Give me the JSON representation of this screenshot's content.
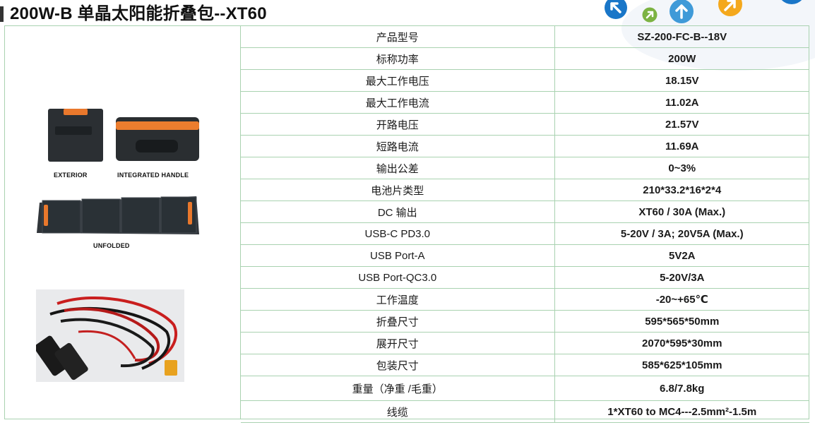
{
  "title": "200W-B 单晶太阳能折叠包--XT60",
  "nav_icons": [
    {
      "name": "arrow-up-left-icon",
      "color": "#1976c8"
    },
    {
      "name": "arrow-up-right-icon",
      "color": "#7cb342"
    },
    {
      "name": "arrow-up-icon",
      "color": "#3f9ad8"
    },
    {
      "name": "arrow-up-right-icon",
      "color": "#f4a81c"
    }
  ],
  "product_image": {
    "labels": {
      "exterior": "EXTERIOR",
      "handle": "INTEGRATED HANDLE",
      "unfolded": "UNFOLDED"
    }
  },
  "specs": [
    {
      "label": "产品型号",
      "value": "SZ-200-FC-B--18V"
    },
    {
      "label": "标称功率",
      "value": "200W"
    },
    {
      "label": "最大工作电压",
      "value": "18.15V"
    },
    {
      "label": "最大工作电流",
      "value": "11.02A"
    },
    {
      "label": "开路电压",
      "value": "21.57V"
    },
    {
      "label": "短路电流",
      "value": "11.69A"
    },
    {
      "label": "输出公差",
      "value": "0~3%"
    },
    {
      "label": "电池片类型",
      "value": "210*33.2*16*2*4"
    },
    {
      "label": "DC 输出",
      "value": "XT60 / 30A (Max.)"
    },
    {
      "label": "USB-C PD3.0",
      "value": "5-20V / 3A; 20V5A (Max.)"
    },
    {
      "label": "USB Port-A",
      "value": "5V2A"
    },
    {
      "label": "USB Port-QC3.0",
      "value": "5-20V/3A"
    },
    {
      "label": "工作温度",
      "value": "-20~+65℃"
    },
    {
      "label": "折叠尺寸",
      "value": "595*565*50mm"
    },
    {
      "label": "展开尺寸",
      "value": "2070*595*30mm"
    },
    {
      "label": "包装尺寸",
      "value": "585*625*105mm"
    },
    {
      "label": "重量（净重 /毛重）",
      "value": "6.8/7.8kg"
    },
    {
      "label": "线缆",
      "value": "1*XT60 to MC4---2.5mm²-1.5m"
    }
  ]
}
